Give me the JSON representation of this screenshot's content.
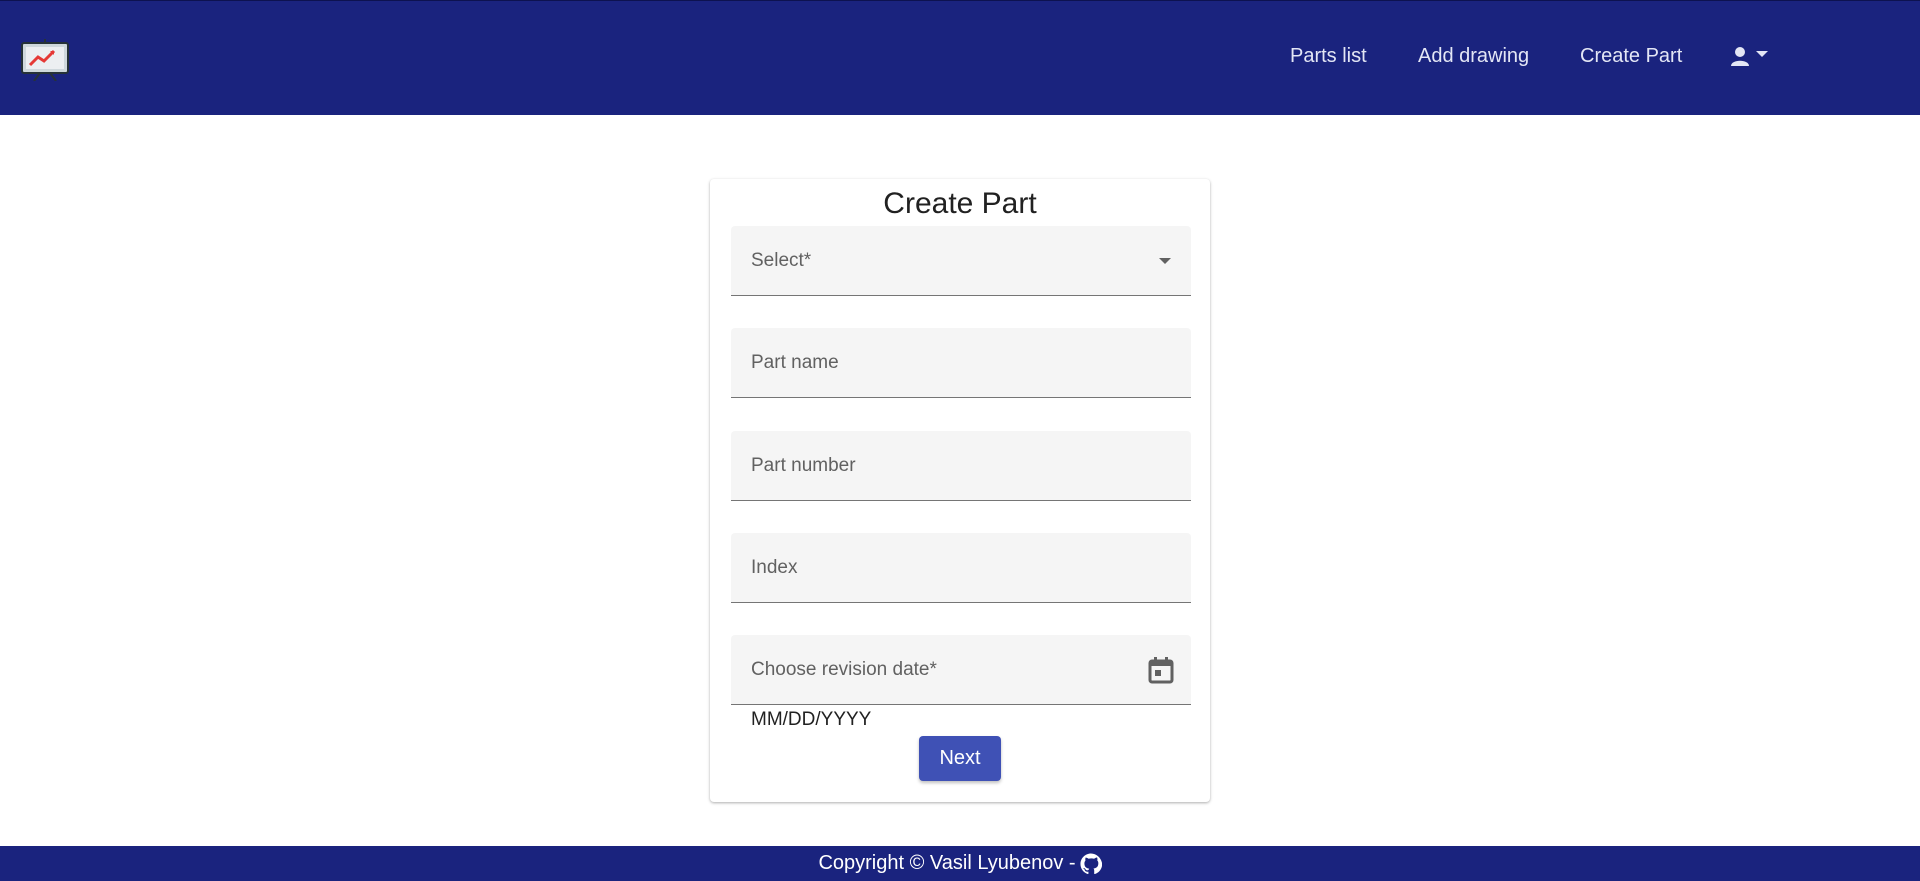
{
  "header": {
    "logo_icon": "presentation-chart-icon",
    "nav": {
      "parts_list": "Parts list",
      "add_drawing": "Add drawing",
      "create_part": "Create Part"
    },
    "user_icon": "account-icon"
  },
  "form": {
    "title": "Create Part",
    "select_label": "Select*",
    "part_name_label": "Part name",
    "part_number_label": "Part number",
    "index_label": "Index",
    "revision_date_label": "Choose revision date*",
    "date_hint": "MM/DD/YYYY",
    "next_label": "Next"
  },
  "footer": {
    "text": "Copyright © Vasil Lyubenov -",
    "icon": "github-icon"
  },
  "colors": {
    "primary": "#1a237e",
    "button": "#3f51b5",
    "field_bg": "#f5f5f5"
  }
}
